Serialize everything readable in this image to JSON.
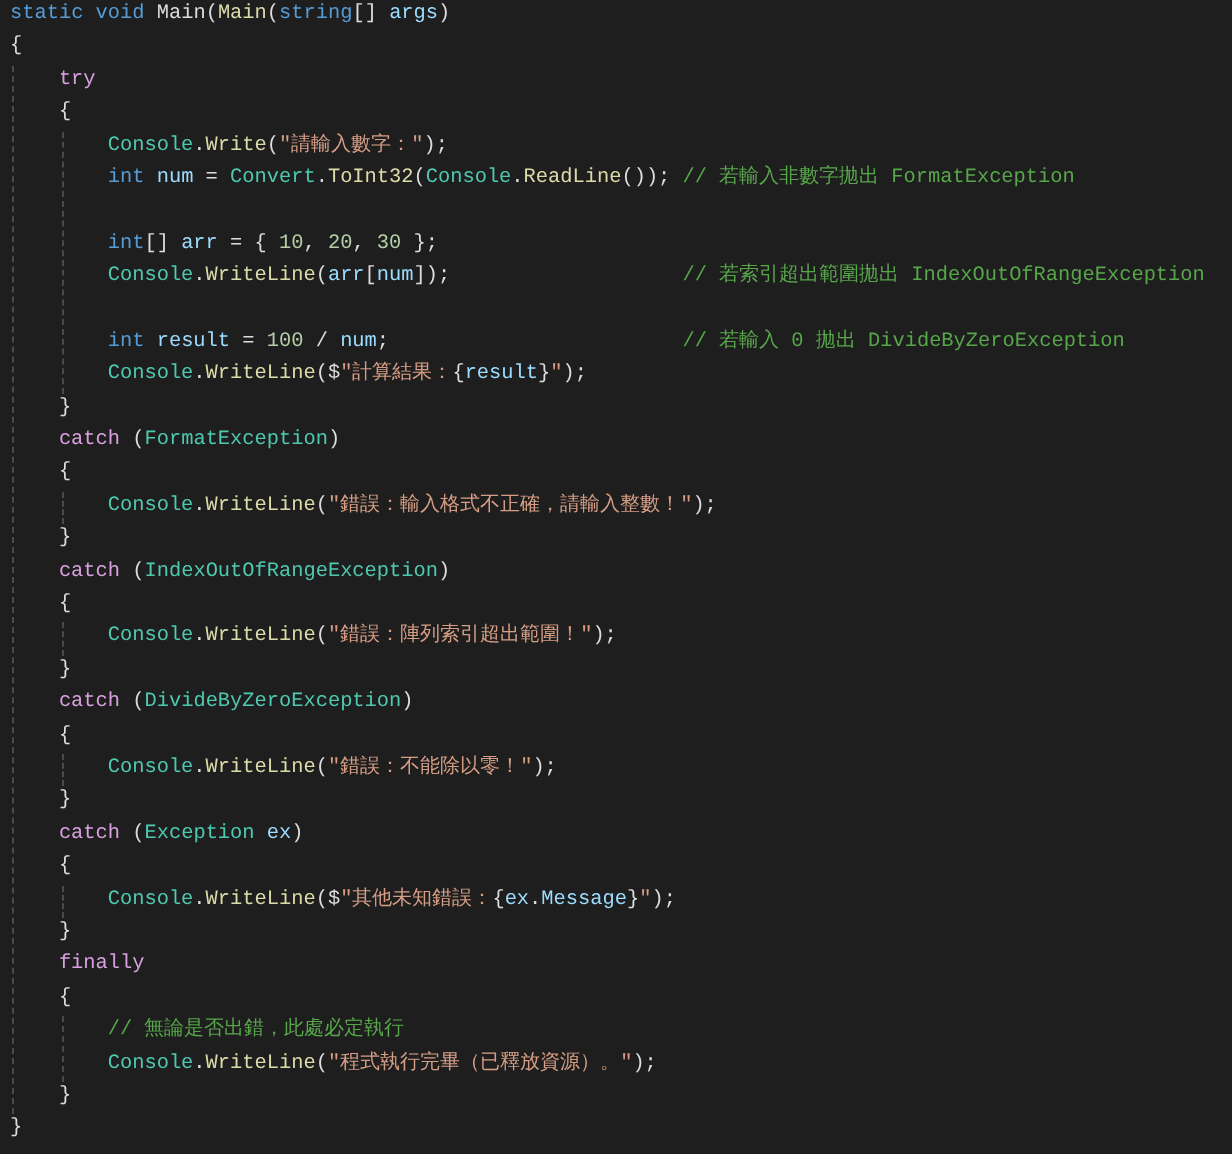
{
  "editor": {
    "lines": [
      {
        "kind": "code",
        "tokens": [
          {
            "kind": "keyword",
            "text": "static void"
          },
          {
            "kind": "plain",
            "text": " Main("
          },
          {
            "kind": "method",
            "text": "Main"
          },
          {
            "kind": "plain",
            "text": "("
          },
          {
            "kind": "keyword",
            "text": "string"
          },
          {
            "kind": "plain",
            "text": "[] "
          },
          {
            "kind": "variable",
            "text": "args"
          },
          {
            "kind": "plain",
            "text": ")"
          }
        ]
      },
      {
        "kind": "code",
        "tokens": [
          {
            "kind": "plain",
            "text": "{"
          }
        ],
        "children": [
          {
            "kind": "code",
            "tokens": [
              {
                "kind": "control",
                "text": "try"
              }
            ]
          },
          {
            "kind": "code",
            "tokens": [
              {
                "kind": "plain",
                "text": "{"
              }
            ],
            "children": [
              {
                "kind": "code",
                "tokens": [
                  {
                    "kind": "type",
                    "text": "Console"
                  },
                  {
                    "kind": "plain",
                    "text": "."
                  },
                  {
                    "kind": "method",
                    "text": "Write"
                  },
                  {
                    "kind": "plain",
                    "text": "("
                  },
                  {
                    "kind": "string",
                    "text": "\"請輸入數字：\""
                  },
                  {
                    "kind": "plain",
                    "text": ");"
                  }
                ]
              },
              {
                "kind": "code",
                "tokens": [
                  {
                    "kind": "keyword",
                    "text": "int "
                  },
                  {
                    "kind": "variable",
                    "text": "num"
                  },
                  {
                    "kind": "plain",
                    "text": " = "
                  },
                  {
                    "kind": "type",
                    "text": "Convert"
                  },
                  {
                    "kind": "plain",
                    "text": "."
                  },
                  {
                    "kind": "method",
                    "text": "ToInt32"
                  },
                  {
                    "kind": "plain",
                    "text": "("
                  },
                  {
                    "kind": "type",
                    "text": "Console"
                  },
                  {
                    "kind": "plain",
                    "text": "."
                  },
                  {
                    "kind": "method",
                    "text": "ReadLine"
                  },
                  {
                    "kind": "plain",
                    "text": "());"
                  },
                  {
                    "kind": "comment",
                    "text": "// 若輸入非數字拋出 FormatException"
                  }
                ]
              },
              {
                "kind": "blank"
              },
              {
                "kind": "code",
                "tokens": [
                  {
                    "kind": "keyword",
                    "text": "int"
                  },
                  {
                    "kind": "plain",
                    "text": "[] "
                  },
                  {
                    "kind": "variable",
                    "text": "arr"
                  },
                  {
                    "kind": "plain",
                    "text": " = { "
                  },
                  {
                    "kind": "number",
                    "text": "10"
                  },
                  {
                    "kind": "plain",
                    "text": ", "
                  },
                  {
                    "kind": "number",
                    "text": "20"
                  },
                  {
                    "kind": "plain",
                    "text": ", "
                  },
                  {
                    "kind": "number",
                    "text": "30"
                  },
                  {
                    "kind": "plain",
                    "text": " };"
                  }
                ]
              },
              {
                "kind": "code",
                "tokens": [
                  {
                    "kind": "type",
                    "text": "Console"
                  },
                  {
                    "kind": "plain",
                    "text": "."
                  },
                  {
                    "kind": "method",
                    "text": "WriteLine"
                  },
                  {
                    "kind": "plain",
                    "text": "("
                  },
                  {
                    "kind": "variable",
                    "text": "arr"
                  },
                  {
                    "kind": "plain",
                    "text": "["
                  },
                  {
                    "kind": "variable",
                    "text": "num"
                  },
                  {
                    "kind": "plain",
                    "text": "]);"
                  },
                  {
                    "kind": "comment",
                    "text": "// 若索引超出範圍拋出 IndexOutOfRangeException"
                  }
                ]
              },
              {
                "kind": "blank"
              },
              {
                "kind": "code",
                "tokens": [
                  {
                    "kind": "keyword",
                    "text": "int "
                  },
                  {
                    "kind": "variable",
                    "text": "result"
                  },
                  {
                    "kind": "plain",
                    "text": " = "
                  },
                  {
                    "kind": "number",
                    "text": "100"
                  },
                  {
                    "kind": "plain",
                    "text": " / "
                  },
                  {
                    "kind": "variable",
                    "text": "num"
                  },
                  {
                    "kind": "plain",
                    "text": ";"
                  },
                  {
                    "kind": "comment",
                    "text": "// 若輸入 0 拋出 DivideByZeroException"
                  }
                ]
              },
              {
                "kind": "code",
                "tokens": [
                  {
                    "kind": "type",
                    "text": "Console"
                  },
                  {
                    "kind": "plain",
                    "text": "."
                  },
                  {
                    "kind": "method",
                    "text": "WriteLine"
                  },
                  {
                    "kind": "plain",
                    "text": "($"
                  },
                  {
                    "kind": "string",
                    "text": "\"計算結果："
                  },
                  {
                    "kind": "plain",
                    "text": "{"
                  },
                  {
                    "kind": "variable",
                    "text": "result"
                  },
                  {
                    "kind": "plain",
                    "text": "}"
                  },
                  {
                    "kind": "string",
                    "text": "\""
                  },
                  {
                    "kind": "plain",
                    "text": ");"
                  }
                ]
              }
            ]
          },
          {
            "kind": "code",
            "tokens": [
              {
                "kind": "plain",
                "text": "}"
              }
            ]
          },
          {
            "kind": "code",
            "tokens": [
              {
                "kind": "control",
                "text": "catch"
              },
              {
                "kind": "plain",
                "text": " ("
              },
              {
                "kind": "type",
                "text": "FormatException"
              },
              {
                "kind": "plain",
                "text": ")"
              }
            ]
          },
          {
            "kind": "code",
            "tokens": [
              {
                "kind": "plain",
                "text": "{"
              }
            ],
            "children": [
              {
                "kind": "code",
                "tokens": [
                  {
                    "kind": "type",
                    "text": "Console"
                  },
                  {
                    "kind": "plain",
                    "text": "."
                  },
                  {
                    "kind": "method",
                    "text": "WriteLine"
                  },
                  {
                    "kind": "plain",
                    "text": "("
                  },
                  {
                    "kind": "string",
                    "text": "\"錯誤：輸入格式不正確，請輸入整數！\""
                  },
                  {
                    "kind": "plain",
                    "text": ");"
                  }
                ]
              }
            ]
          },
          {
            "kind": "code",
            "tokens": [
              {
                "kind": "plain",
                "text": "}"
              }
            ]
          },
          {
            "kind": "code",
            "tokens": [
              {
                "kind": "control",
                "text": "catch"
              },
              {
                "kind": "plain",
                "text": " ("
              },
              {
                "kind": "type",
                "text": "IndexOutOfRangeException"
              },
              {
                "kind": "plain",
                "text": ")"
              }
            ]
          },
          {
            "kind": "code",
            "tokens": [
              {
                "kind": "plain",
                "text": "{"
              }
            ],
            "children": [
              {
                "kind": "code",
                "tokens": [
                  {
                    "kind": "type",
                    "text": "Console"
                  },
                  {
                    "kind": "plain",
                    "text": "."
                  },
                  {
                    "kind": "method",
                    "text": "WriteLine"
                  },
                  {
                    "kind": "plain",
                    "text": "("
                  },
                  {
                    "kind": "string",
                    "text": "\"錯誤：陣列索引超出範圍！\""
                  },
                  {
                    "kind": "plain",
                    "text": ");"
                  }
                ]
              }
            ]
          },
          {
            "kind": "code",
            "tokens": [
              {
                "kind": "plain",
                "text": "}"
              }
            ]
          },
          {
            "kind": "code",
            "tokens": [
              {
                "kind": "control",
                "text": "catch"
              },
              {
                "kind": "plain",
                "text": " ("
              },
              {
                "kind": "type",
                "text": "DivideByZeroException"
              },
              {
                "kind": "plain",
                "text": ")"
              }
            ]
          },
          {
            "kind": "code",
            "tokens": [
              {
                "kind": "plain",
                "text": "{"
              }
            ],
            "children": [
              {
                "kind": "code",
                "tokens": [
                  {
                    "kind": "type",
                    "text": "Console"
                  },
                  {
                    "kind": "plain",
                    "text": "."
                  },
                  {
                    "kind": "method",
                    "text": "WriteLine"
                  },
                  {
                    "kind": "plain",
                    "text": "("
                  },
                  {
                    "kind": "string",
                    "text": "\"錯誤：不能除以零！\""
                  },
                  {
                    "kind": "plain",
                    "text": ");"
                  }
                ]
              }
            ]
          },
          {
            "kind": "code",
            "tokens": [
              {
                "kind": "plain",
                "text": "}"
              }
            ]
          },
          {
            "kind": "code",
            "tokens": [
              {
                "kind": "control",
                "text": "catch"
              },
              {
                "kind": "plain",
                "text": " ("
              },
              {
                "kind": "type",
                "text": "Exception "
              },
              {
                "kind": "variable",
                "text": "ex"
              },
              {
                "kind": "plain",
                "text": ")"
              }
            ]
          },
          {
            "kind": "code",
            "tokens": [
              {
                "kind": "plain",
                "text": "{"
              }
            ],
            "children": [
              {
                "kind": "code",
                "tokens": [
                  {
                    "kind": "type",
                    "text": "Console"
                  },
                  {
                    "kind": "plain",
                    "text": "."
                  },
                  {
                    "kind": "method",
                    "text": "WriteLine"
                  },
                  {
                    "kind": "plain",
                    "text": "($"
                  },
                  {
                    "kind": "string",
                    "text": "\"其他未知錯誤："
                  },
                  {
                    "kind": "plain",
                    "text": "{"
                  },
                  {
                    "kind": "variable",
                    "text": "ex"
                  },
                  {
                    "kind": "plain",
                    "text": "."
                  },
                  {
                    "kind": "variable",
                    "text": "Message"
                  },
                  {
                    "kind": "plain",
                    "text": "}"
                  },
                  {
                    "kind": "string",
                    "text": "\""
                  },
                  {
                    "kind": "plain",
                    "text": ");"
                  }
                ]
              }
            ]
          },
          {
            "kind": "code",
            "tokens": [
              {
                "kind": "plain",
                "text": "}"
              }
            ]
          },
          {
            "kind": "code",
            "tokens": [
              {
                "kind": "control",
                "text": "finally"
              }
            ]
          },
          {
            "kind": "code",
            "tokens": [
              {
                "kind": "plain",
                "text": "{"
              }
            ],
            "children": [
              {
                "kind": "code",
                "tokens": [
                  {
                    "kind": "comment",
                    "text": "// 無論是否出錯，此處必定執行"
                  }
                ]
              },
              {
                "kind": "code",
                "tokens": [
                  {
                    "kind": "type",
                    "text": "Console"
                  },
                  {
                    "kind": "plain",
                    "text": "."
                  },
                  {
                    "kind": "method",
                    "text": "WriteLine"
                  },
                  {
                    "kind": "plain",
                    "text": "("
                  },
                  {
                    "kind": "string",
                    "text": "\"程式執行完畢（已釋放資源）。\""
                  },
                  {
                    "kind": "plain",
                    "text": ");"
                  }
                ]
              }
            ]
          },
          {
            "kind": "code",
            "tokens": [
              {
                "kind": "plain",
                "text": "}"
              }
            ]
          }
        ]
      },
      {
        "kind": "code",
        "tokens": [
          {
            "kind": "plain",
            "text": "}"
          }
        ]
      }
    ]
  }
}
